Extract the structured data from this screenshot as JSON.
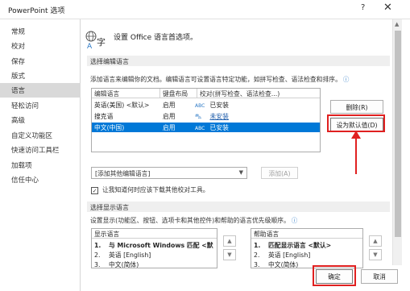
{
  "window": {
    "title": "PowerPoint 选项",
    "help": "?",
    "close": "✕"
  },
  "sidebar": {
    "items": [
      {
        "label": "常规"
      },
      {
        "label": "校对"
      },
      {
        "label": "保存"
      },
      {
        "label": "版式"
      },
      {
        "label": "语言",
        "active": true
      },
      {
        "label": "轻松访问"
      },
      {
        "label": "高级"
      },
      {
        "label": "自定义功能区"
      },
      {
        "label": "快速访问工具栏"
      },
      {
        "label": "加载项"
      },
      {
        "label": "信任中心"
      }
    ]
  },
  "header": {
    "text": "设置 Office 语言首选项。",
    "icon_glyph": "字"
  },
  "editing": {
    "section_title": "选择编辑语言",
    "description": "添加语言来编辑你的文档。编辑语言可设置语言特定功能，如拼写检查、语法检查和排序。",
    "info_icon": "ⓘ",
    "columns": [
      "编辑语言",
      "键盘布局",
      "校对(拼写检查、语法检查...)"
    ],
    "rows": [
      {
        "language": "英语(美国) <默认>",
        "keyboard": "启用",
        "status": "已安装",
        "status_icon": "ABC",
        "link": false
      },
      {
        "language": "搜克语",
        "keyboard": "启用",
        "status": "未安装",
        "status_icon": "⛍",
        "link": true
      },
      {
        "language": "中文(中国)",
        "keyboard": "启用",
        "status": "已安装",
        "status_icon": "ABC",
        "link": false,
        "selected": true
      }
    ],
    "remove_button": "删除(R)",
    "default_button": "设为默认值(D)",
    "add_dropdown": "[添加其他编辑语言]",
    "add_button": "添加(A)",
    "checkbox_label": "让我知道何时应该下载其他校对工具。",
    "checkbox_checked": true
  },
  "display": {
    "section_title": "选择显示语言",
    "description": "设置显示(功能区、按钮、选项卡和其他控件)和帮助的语言优先级顺序。",
    "display_list": {
      "header": "显示语言",
      "items": [
        {
          "num": "1.",
          "label": "与 Microsoft Windows 匹配 <默",
          "bold": true
        },
        {
          "num": "2.",
          "label": "英语 [English]"
        },
        {
          "num": "3.",
          "label": "中文(简体)"
        }
      ]
    },
    "help_list": {
      "header": "帮助语言",
      "items": [
        {
          "num": "1.",
          "label": "匹配显示语言 <默认>",
          "bold": true
        },
        {
          "num": "2.",
          "label": "英语 [English]"
        },
        {
          "num": "3.",
          "label": "中文(简体)"
        }
      ]
    }
  },
  "footer": {
    "ok_button": "确定",
    "cancel_button": "取消"
  },
  "colors": {
    "accent": "#0078d7",
    "annotation": "#e02020"
  }
}
